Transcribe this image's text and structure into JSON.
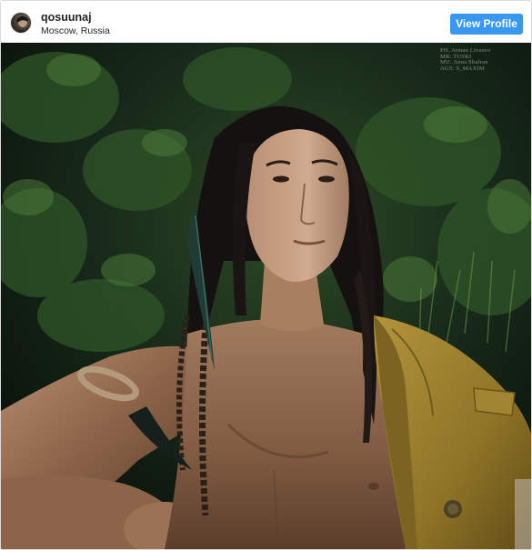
{
  "post_header": {
    "username": "qosuunaj",
    "location": "Moscow, Russia",
    "view_profile_label": "View Profile"
  },
  "photo": {
    "credits": [
      "PH. Arman Livanov",
      "MR: TUSKI",
      "MU: Anna Shafran",
      "AGS: S_MAXIM"
    ]
  },
  "colors": {
    "button_blue": "#3897f0",
    "text_dark": "#262626",
    "border": "#dbdbdb",
    "foliage_dark": "#12200f",
    "jacket_mustard": "#9a7f2c"
  },
  "icons": {
    "avatar": "user-avatar-photo"
  }
}
